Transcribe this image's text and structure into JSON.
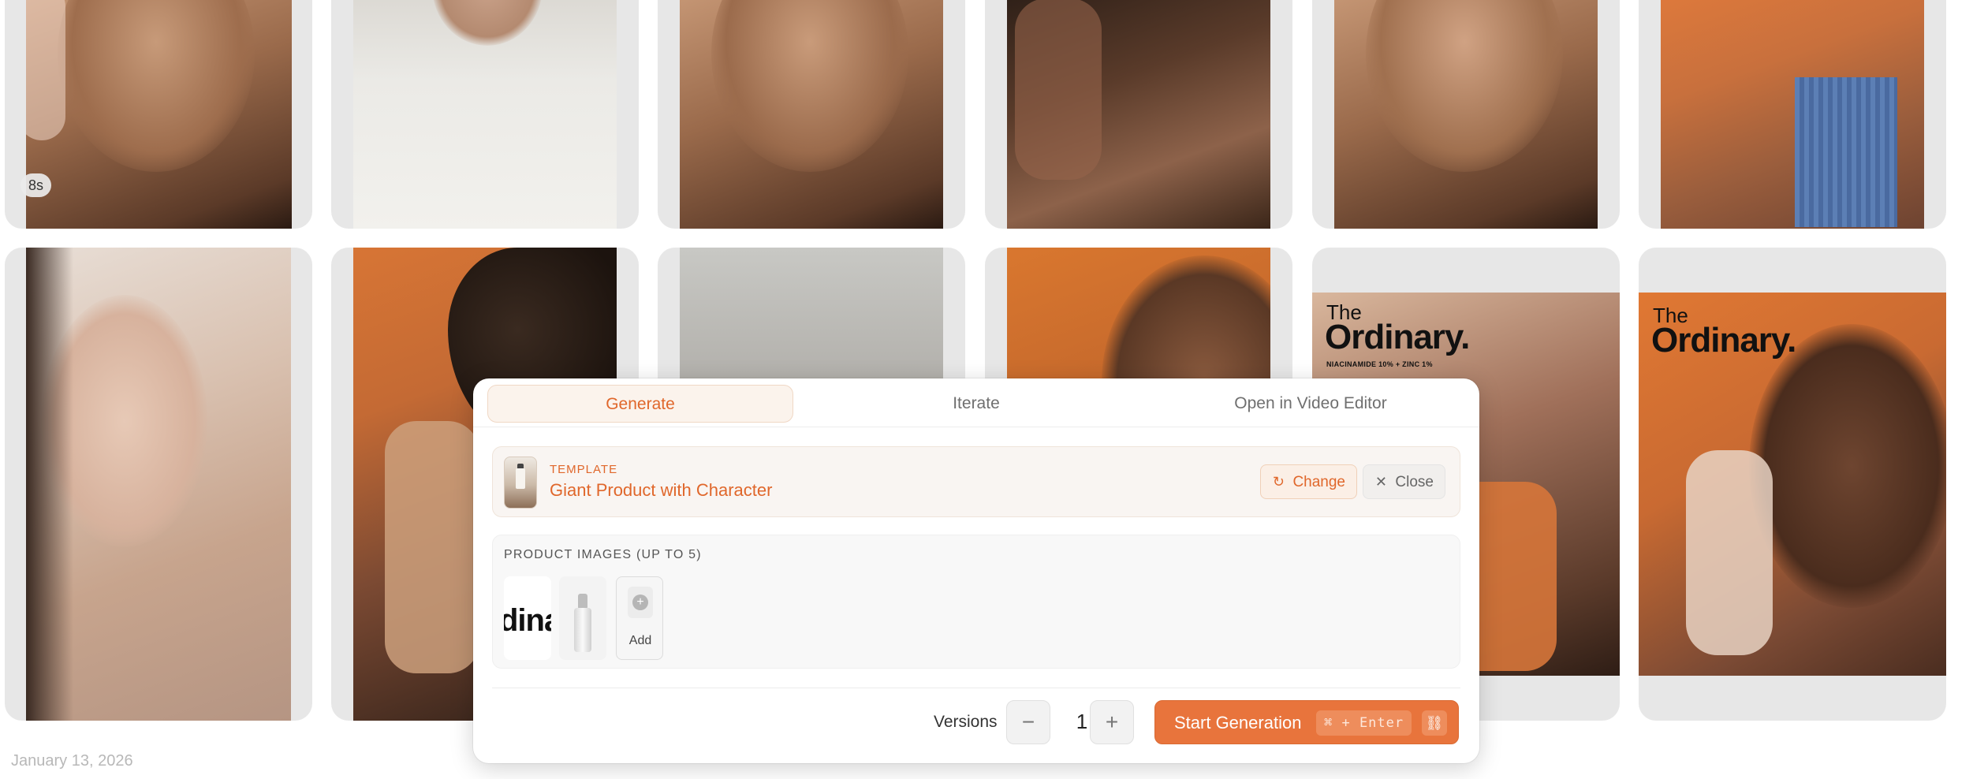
{
  "gallery": {
    "duration_badge": "8s",
    "date_label": "January 13, 2026",
    "brand_left": {
      "the": "The",
      "name": "Ordinary.",
      "sub": "NIACINAMIDE 10% + ZINC 1%"
    },
    "brand_right": {
      "the": "The",
      "name": "Ordinary."
    }
  },
  "panel": {
    "tabs": [
      {
        "label": "Generate",
        "active": true
      },
      {
        "label": "Iterate",
        "active": false
      },
      {
        "label": "Open in Video Editor",
        "active": false
      }
    ],
    "template": {
      "kicker": "TEMPLATE",
      "name": "Giant Product with Character",
      "change_label": "Change",
      "close_label": "Close"
    },
    "product_images": {
      "label": "PRODUCT IMAGES (UP TO 5)",
      "logo_text": "dina",
      "add_label": "Add"
    },
    "footer": {
      "versions_label": "Versions",
      "minus": "−",
      "plus": "+",
      "versions_value": "1",
      "start_label": "Start Generation",
      "shortcut": "⌘ + Enter"
    }
  },
  "colors": {
    "accent": "#e8743c",
    "accent_text": "#e0672b"
  },
  "icons": [
    "refresh-icon",
    "close-icon",
    "plus-icon",
    "link-icon"
  ]
}
